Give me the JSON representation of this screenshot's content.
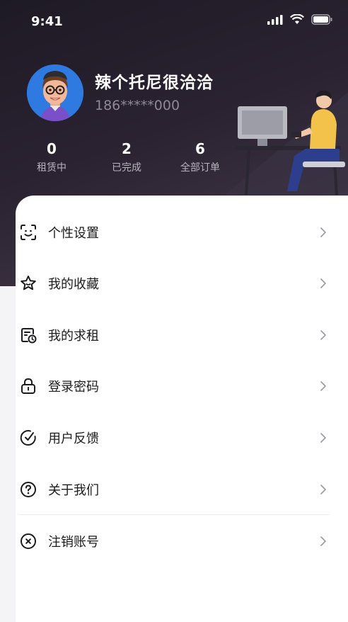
{
  "status_bar": {
    "time": "9:41"
  },
  "profile": {
    "name": "辣个托尼很洽洽",
    "phone": "186*****000"
  },
  "stats": [
    {
      "value": "0",
      "label": "租赁中"
    },
    {
      "value": "2",
      "label": "已完成"
    },
    {
      "value": "6",
      "label": "全部订单"
    }
  ],
  "menu": [
    {
      "label": "个性设置",
      "icon": "face-settings-icon"
    },
    {
      "label": "我的收藏",
      "icon": "star-icon"
    },
    {
      "label": "我的求租",
      "icon": "document-clock-icon"
    },
    {
      "label": "登录密码",
      "icon": "lock-icon"
    },
    {
      "label": "用户反馈",
      "icon": "feedback-icon"
    },
    {
      "label": "关于我们",
      "icon": "question-icon"
    },
    {
      "label": "注销账号",
      "icon": "close-circle-icon"
    }
  ],
  "colors": {
    "header_dark": "#241e2a",
    "accent_avatar": "#2f7ae0",
    "text_primary": "#1c1c1e",
    "text_muted": "#8d8898"
  }
}
